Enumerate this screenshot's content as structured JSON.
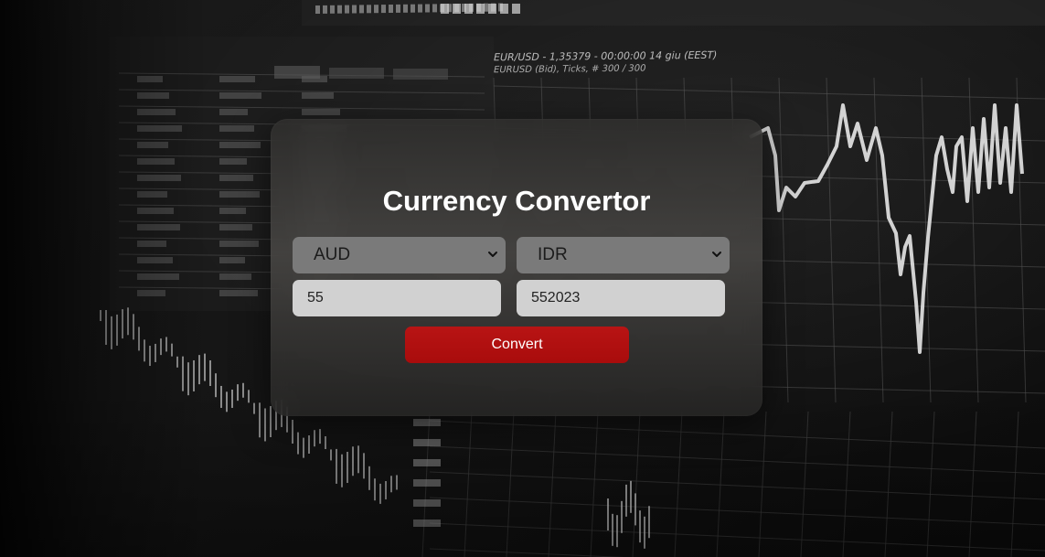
{
  "app": {
    "title": "Currency Convertor"
  },
  "converter": {
    "from_currency": "AUD",
    "to_currency": "IDR",
    "amount_value": "55",
    "result_value": "552023",
    "convert_label": "Convert"
  },
  "background": {
    "caption": "EUR/USD - 1,35379 - 00:00:00  14 giu (EEST)",
    "subcaption": "EURUSD (Bid), Ticks, # 300 / 300"
  },
  "colors": {
    "button": "#b10f0f",
    "select_bg": "#808080",
    "input_bg": "#d1d1d1",
    "title": "#ffffff"
  },
  "icons": {
    "select_arrow": "chevron-down-icon"
  }
}
